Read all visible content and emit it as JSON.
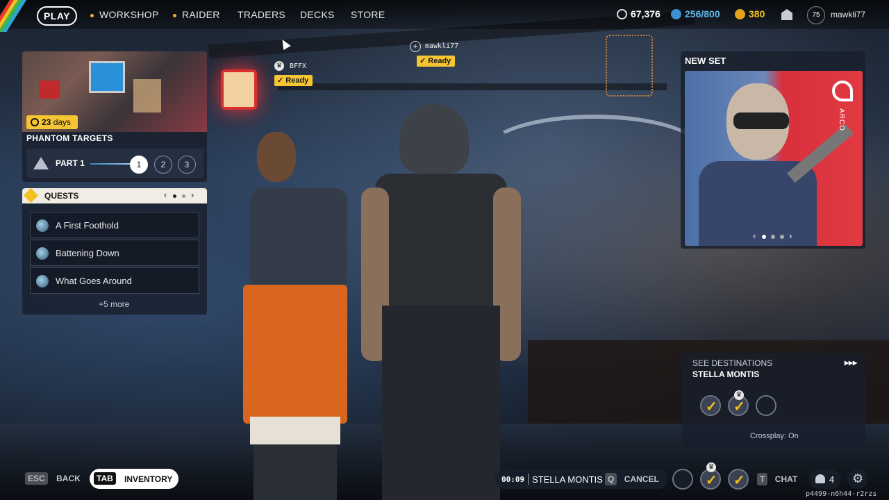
{
  "nav": {
    "play": "PLAY",
    "items": [
      "WORKSHOP",
      "RAIDER",
      "TRADERS",
      "DECKS",
      "STORE"
    ]
  },
  "currencies": {
    "coins": "67,376",
    "storage": "256/800",
    "tokens": "380"
  },
  "profile": {
    "level": "75",
    "username": "mawkli77"
  },
  "event": {
    "days_number": "23",
    "days_unit": "days",
    "title": "PHANTOM TARGETS",
    "part_label": "PART 1",
    "steps": [
      "1",
      "2",
      "3"
    ],
    "active_step": 1
  },
  "quests": {
    "title": "QUESTS",
    "items": [
      "A First Foothold",
      "Battening Down",
      "What Goes Around"
    ],
    "more": "+5 more"
  },
  "party_tags": [
    {
      "name": "BFFX",
      "status": "Ready"
    },
    {
      "name": "mawkli77",
      "status": "Ready"
    }
  ],
  "new_set": {
    "title": "NEW SET",
    "brand": "ARCO"
  },
  "destinations": {
    "header": "SEE DESTINATIONS",
    "location": "STELLA MONTIS",
    "crossplay": "Crossplay: On"
  },
  "bottom": {
    "esc_key": "ESC",
    "back": "BACK",
    "tab_key": "TAB",
    "inventory": "INVENTORY",
    "timer": "00:09",
    "queue_location": "STELLA MONTIS",
    "cancel_key": "Q",
    "cancel": "CANCEL",
    "chat_key": "T",
    "chat": "CHAT",
    "party_count": "4",
    "session_id": "p4499-n6h44-r2rzs"
  },
  "colors": {
    "accent": "#f5c533",
    "panel": "#181e2c"
  }
}
